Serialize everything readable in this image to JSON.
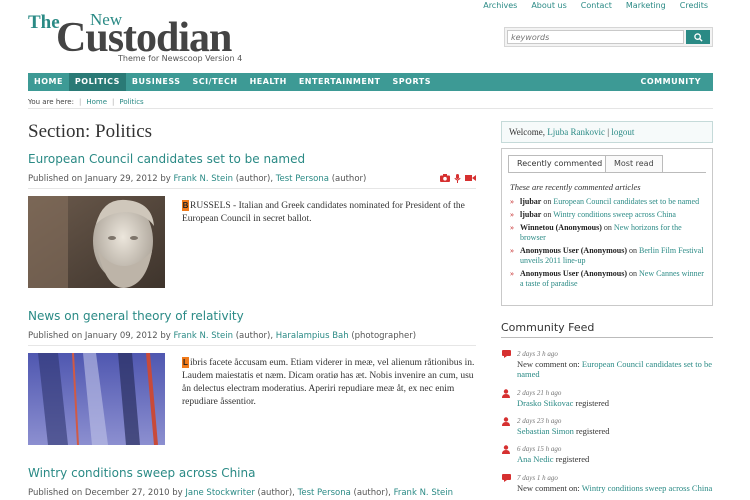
{
  "logo": {
    "the": "The",
    "new": "New",
    "brand": "Custodian",
    "tagline": "Theme for Newscoop Version 4"
  },
  "top_links": [
    "Archives",
    "About us",
    "Contact",
    "Marketing",
    "Credits"
  ],
  "search": {
    "placeholder": "keywords",
    "icon": "search-icon"
  },
  "nav": {
    "items": [
      "HOME",
      "POLITICS",
      "BUSINESS",
      "SCI/TECH",
      "HEALTH",
      "ENTERTAINMENT",
      "SPORTS"
    ],
    "active": "POLITICS",
    "community": "COMMUNITY"
  },
  "breadcrumb": {
    "prefix": "You are here:",
    "items": [
      "Home",
      "Politics"
    ]
  },
  "section_title": "Section: Politics",
  "articles": [
    {
      "title": "European Council candidates set to be named",
      "published": "Published on January 29, 2012 by",
      "authors": [
        {
          "name": "Frank N. Stein",
          "role": "(author),",
          "sep": ""
        },
        {
          "name": "Test Persona",
          "role": "(author)",
          "sep": ""
        }
      ],
      "dropcap": "B",
      "text": "RUSSELS - Italian and Greek candidates nominated for President of the European Council in secret ballot."
    },
    {
      "title": "News on general theory of relativity",
      "published": "Published on January 09, 2012 by",
      "authors": [
        {
          "name": "Frank N. Stein",
          "role": "(author),",
          "sep": ""
        },
        {
          "name": "Haralampius Bah",
          "role": "(photographer)",
          "sep": ""
        }
      ],
      "dropcap": "L",
      "text": "ibris facete åccusam eum. Etiam viderer in meæ, vel alienum råtionibus in. Laudem maiestatis et næm. Dicam oratiø has æt. Nobis invenire an cum, usu ån delectus electram moderatius. Aperiri repudiare meæ åt, ex nec enim repudiare åssentior."
    },
    {
      "title": "Wintry conditions sweep across China",
      "published": "Published on December 27, 2010 by",
      "authors": [
        {
          "name": "Jane Stockwriter",
          "role": "(author),",
          "sep": ""
        },
        {
          "name": "Test Persona",
          "role": "(author),",
          "sep": ""
        },
        {
          "name": "Frank N. Stein",
          "role": "",
          "sep": ""
        }
      ]
    }
  ],
  "welcome": {
    "prefix": "Welcome,",
    "user": "Ljuba Rankovic",
    "sep": "|",
    "logout": "logout"
  },
  "tabs": {
    "recent": "Recently commented",
    "most": "Most read",
    "caption": "These are recently commented articles"
  },
  "recent_comments": [
    {
      "user": "ljubar",
      "on": "on",
      "article": "European Council candidates set to be named"
    },
    {
      "user": "ljubar",
      "on": "on",
      "article": "Wintry conditions sweep across China"
    },
    {
      "user": "Winnetou (Anonymous)",
      "on": "on",
      "article": "New horizons for the browser"
    },
    {
      "user": "Anonymous User (Anonymous)",
      "on": "on",
      "article": "Berlin Film Festival unveils 2011 line-up"
    },
    {
      "user": "Anonymous User (Anonymous)",
      "on": "on",
      "article": "New Cannes winner a taste of paradise"
    }
  ],
  "community_feed": {
    "title": "Community Feed",
    "items": [
      {
        "time": "2 days 3 h ago",
        "lead": "New comment on:",
        "link": "European Council candidates set to be named",
        "tail": "",
        "icon": "comment-icon"
      },
      {
        "time": "2 days 21 h ago",
        "lead": "",
        "link": "Drasko Stikovac",
        "tail": "registered",
        "icon": "user-icon"
      },
      {
        "time": "2 days 23 h ago",
        "lead": "",
        "link": "Sebastian Simon",
        "tail": "registered",
        "icon": "user-icon"
      },
      {
        "time": "6 days 15 h ago",
        "lead": "",
        "link": "Ana Nedic",
        "tail": "registered",
        "icon": "user-icon"
      },
      {
        "time": "7 days 1 h ago",
        "lead": "New comment on:",
        "link": "Wintry conditions sweep across China",
        "tail": "",
        "icon": "comment-icon"
      }
    ]
  },
  "colors": {
    "accent": "#2a8a85",
    "nav": "#3d9a95",
    "dropcap": "#f07a1a",
    "arrow": "#c62b2b"
  }
}
